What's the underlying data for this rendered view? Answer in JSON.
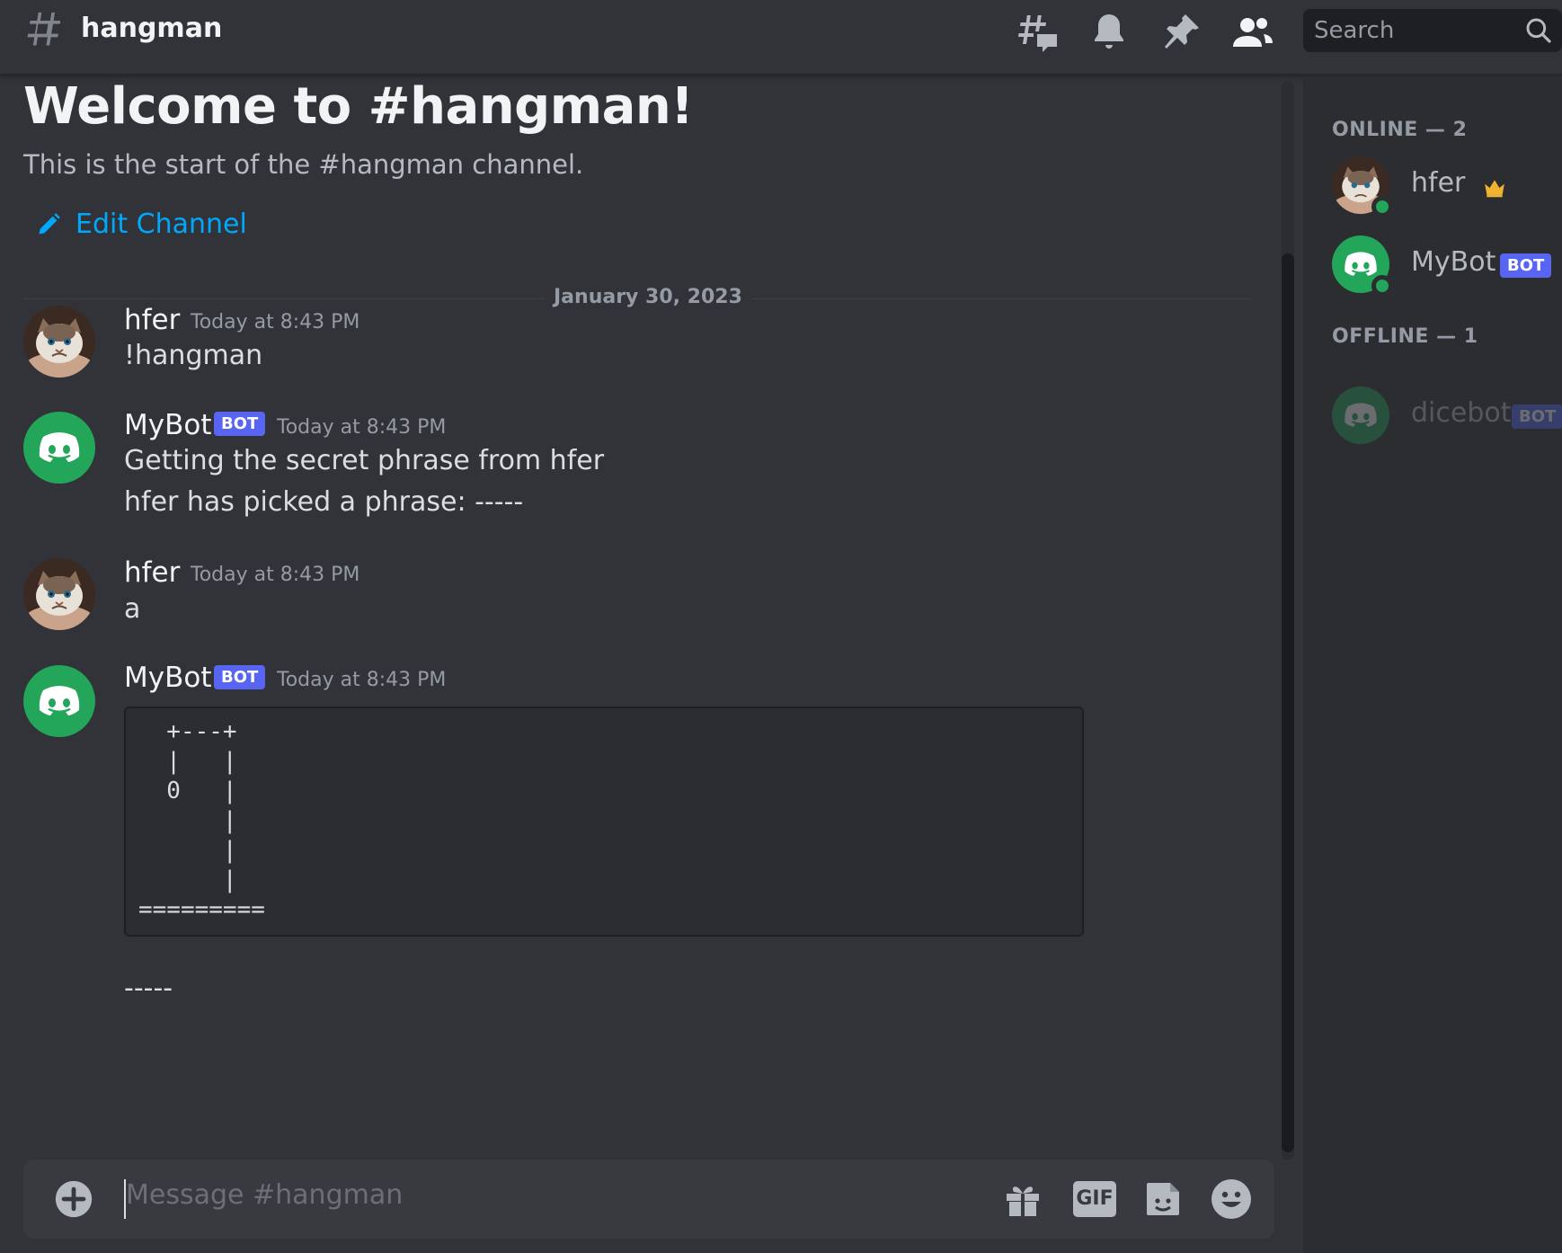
{
  "header": {
    "channel_name": "hangman",
    "search_placeholder": "Search",
    "icons": [
      "threads-icon",
      "bell-icon",
      "pin-icon",
      "members-icon",
      "search-icon"
    ]
  },
  "welcome": {
    "title": "Welcome to #hangman!",
    "subtitle": "This is the start of the #hangman channel.",
    "edit_channel": "Edit Channel"
  },
  "divider_date": "January 30, 2023",
  "messages": [
    {
      "author": "hfer",
      "timestamp": "Today at 8:43 PM",
      "lines": [
        "!hangman"
      ]
    },
    {
      "author": "MyBot",
      "bot_tag": "BOT",
      "timestamp": "Today at 8:43 PM",
      "lines": [
        "Getting the secret phrase from hfer",
        "hfer has picked a phrase: -----"
      ]
    },
    {
      "author": "hfer",
      "timestamp": "Today at 8:43 PM",
      "lines": [
        "a"
      ]
    },
    {
      "author": "MyBot",
      "bot_tag": "BOT",
      "timestamp": "Today at 8:43 PM",
      "code": "  +---+\n  |   |\n  0   |\n      |\n      |\n      |\n=========",
      "after": "-----"
    }
  ],
  "composer": {
    "placeholder": "Message #hangman",
    "icons": [
      "add-icon",
      "gift-icon",
      "gif-icon",
      "sticker-icon",
      "emoji-icon"
    ],
    "gif_label": "GIF"
  },
  "members": {
    "online_label": "ONLINE — 2",
    "offline_label": "OFFLINE — 1",
    "online": [
      {
        "name": "hfer",
        "owner": true
      },
      {
        "name": "MyBot",
        "bot_tag": "BOT"
      }
    ],
    "offline": [
      {
        "name": "dicebot",
        "bot_tag": "BOT"
      }
    ]
  },
  "colors": {
    "background": "#313338",
    "sidebar": "#2b2d31",
    "blurple": "#5865f2",
    "link": "#00a8fc",
    "online": "#23a55a",
    "crown": "#f0b232"
  }
}
